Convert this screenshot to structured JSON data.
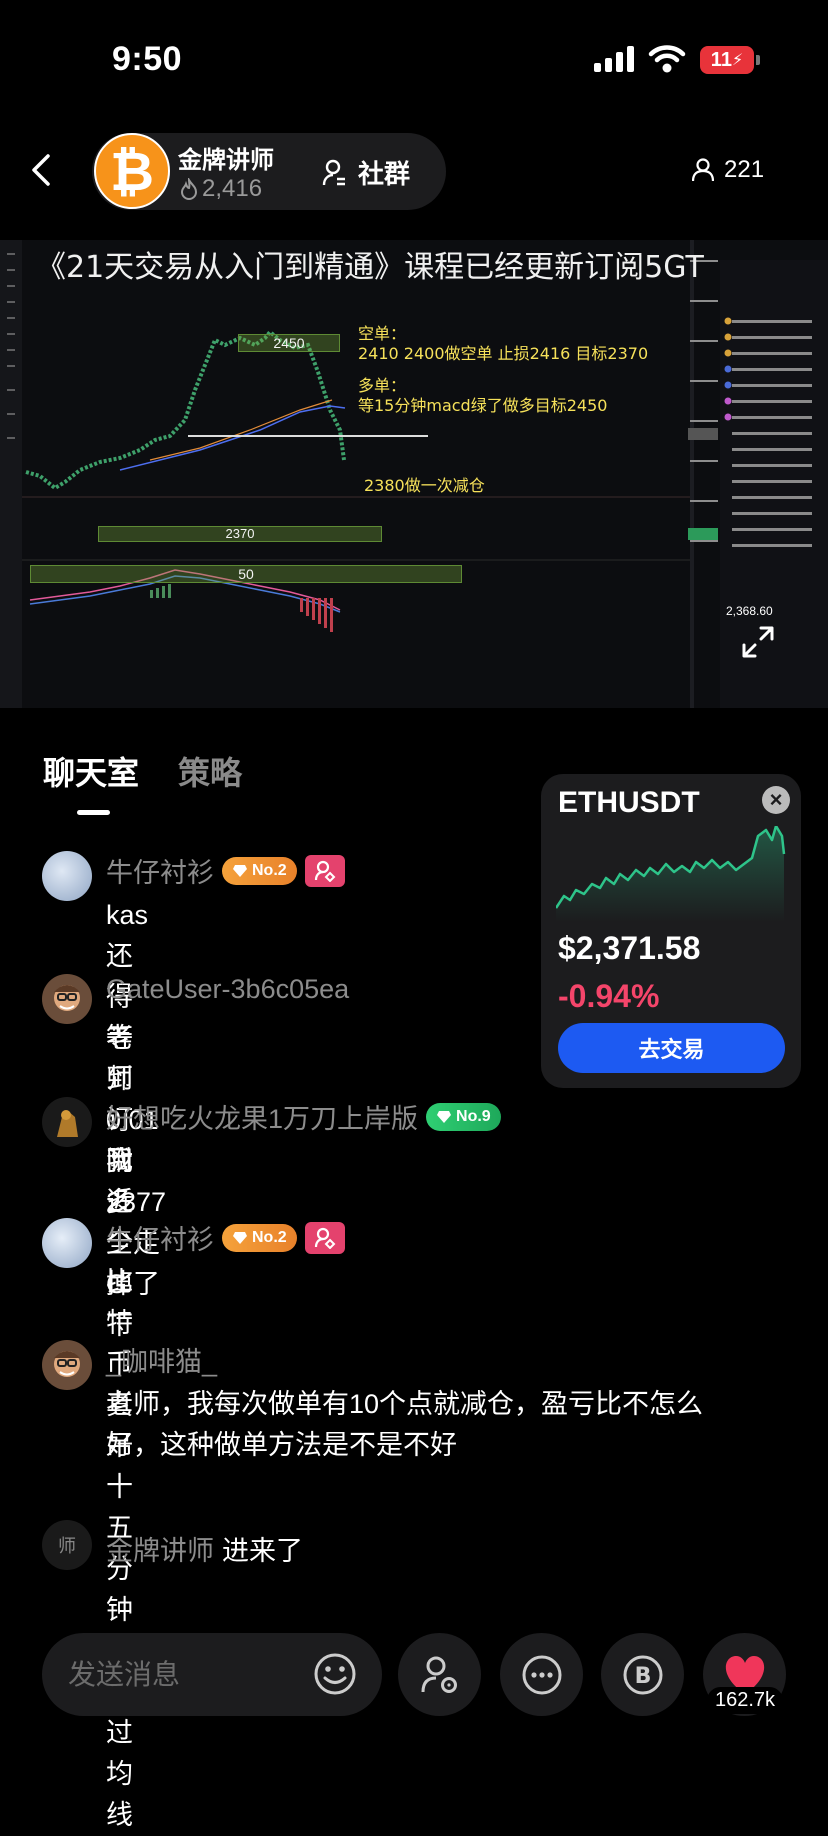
{
  "status_bar": {
    "time": "9:50",
    "battery": "11"
  },
  "header": {
    "host_name": "金牌讲师",
    "host_heat": "2,416",
    "community_label": "社群",
    "viewer_count": "221"
  },
  "video": {
    "banner": "《21天交易从入门到精通》课程已经更新订阅5GT",
    "notes": {
      "short_title": "空单：",
      "short_detail": "2410 2400做空单  止损2416  目标2370",
      "long_title": "多单：",
      "long_detail": "等15分钟macd绿了做多目标2450",
      "reduce": "2380做一次减仓",
      "zone_2450": "2450",
      "zone_2370": "2370",
      "zone_50": "50"
    },
    "side_price": "2,368.60"
  },
  "tabs": [
    {
      "label": "聊天室",
      "active": true
    },
    {
      "label": "策略",
      "active": false
    }
  ],
  "messages": [
    {
      "user": "牛仔衬衫",
      "badge": "No.2",
      "badge_color": "orange",
      "pink_icon": true,
      "text": "kas还得等到0.01附近"
    },
    {
      "user": "GateUser-3b6c05ea",
      "text": "老师订阅多少G丅"
    },
    {
      "user": "好想吃火龙果1万刀上岸版",
      "badge": "No.9",
      "badge_color": "green",
      "text": "我2377全走掉了"
    },
    {
      "user": "牛仔衬衫",
      "badge": "No.2",
      "badge_color": "orange",
      "pink_icon": true,
      "text": "比特币真吊十五分钟没下过均线"
    },
    {
      "user": "_咖啡猫_",
      "text_line1": "老师，我每次做单有10个点就减仓，盈亏比不怎么",
      "text_line2": "好，这种做单方法是不是不好"
    },
    {
      "avatar_text": "师",
      "user": "金牌讲师",
      "text": "进来了"
    }
  ],
  "ticker": {
    "symbol": "ETHUSDT",
    "price": "$2,371.58",
    "change": "-0.94%",
    "trade_label": "去交易",
    "accent_up": "#2ec48a",
    "accent_down": "#f4456a"
  },
  "bottom_bar": {
    "input_placeholder": "发送消息",
    "like_count": "162.7k"
  }
}
